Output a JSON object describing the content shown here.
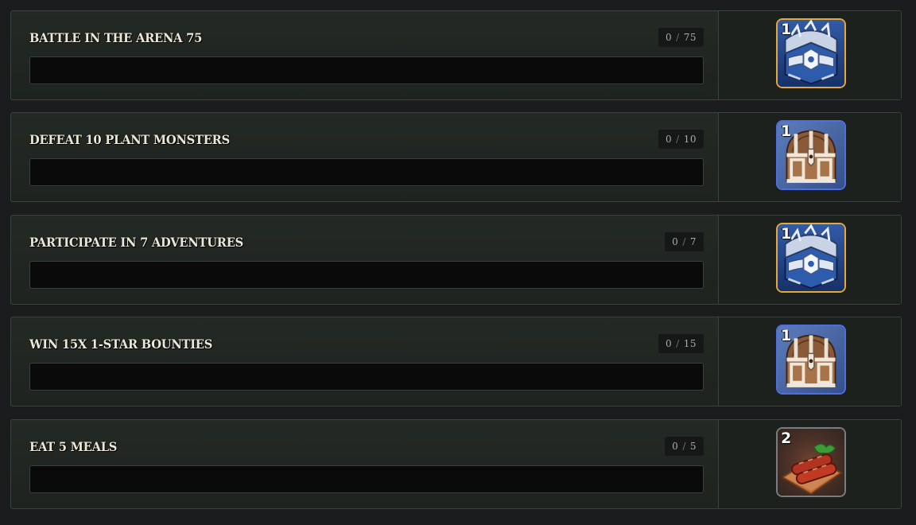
{
  "quests": [
    {
      "title": "BATTLE IN THE ARENA 75",
      "current": "0",
      "target": "75",
      "progress": 0,
      "reward": {
        "icon": "silver-chest-icon",
        "quantity": "1",
        "rarity_color": "#e5a93a"
      }
    },
    {
      "title": "DEFEAT 10 PLANT MONSTERS",
      "current": "0",
      "target": "10",
      "progress": 0,
      "reward": {
        "icon": "wooden-chest-icon",
        "quantity": "1",
        "rarity_color": "#4d6fe0"
      }
    },
    {
      "title": "PARTICIPATE IN 7 ADVENTURES",
      "current": "0",
      "target": "7",
      "progress": 0,
      "reward": {
        "icon": "silver-chest-icon",
        "quantity": "1",
        "rarity_color": "#e5a93a"
      }
    },
    {
      "title": "WIN 15X 1-STAR BOUNTIES",
      "current": "0",
      "target": "15",
      "progress": 0,
      "reward": {
        "icon": "wooden-chest-icon",
        "quantity": "1",
        "rarity_color": "#4d6fe0"
      }
    },
    {
      "title": "EAT 5 MEALS",
      "current": "0",
      "target": "5",
      "progress": 0,
      "reward": {
        "icon": "sausage-meal-icon",
        "quantity": "2",
        "rarity_color": "#7a7d80"
      }
    }
  ],
  "counter_separator": "/"
}
